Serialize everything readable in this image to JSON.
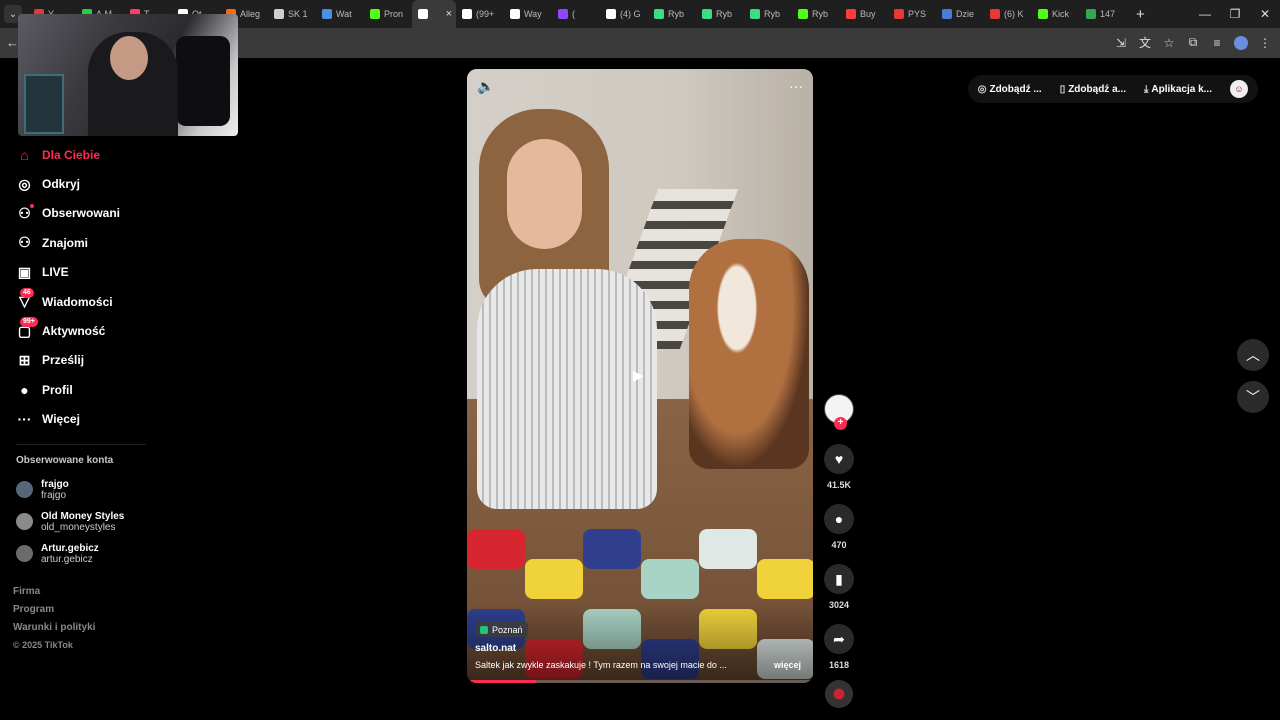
{
  "browser": {
    "tabs": [
      {
        "label": "Y",
        "color": "#e53935"
      },
      {
        "label": "A.M",
        "color": "#2ecc40"
      },
      {
        "label": "T",
        "color": "#ff3b6b"
      },
      {
        "label": "Ot",
        "color": "#ffffff"
      },
      {
        "label": "Alleg",
        "color": "#ff6a00"
      },
      {
        "label": "SK 1",
        "color": "#cfcfcf"
      },
      {
        "label": "Wat",
        "color": "#4a90e2"
      },
      {
        "label": "Pron",
        "color": "#53fc18"
      },
      {
        "label": "",
        "color": "#ffffff",
        "active": true
      },
      {
        "label": "(99+",
        "color": "#ffffff"
      },
      {
        "label": "Way",
        "color": "#ffffff"
      },
      {
        "label": "(",
        "color": "#9146ff"
      },
      {
        "label": "(4) G",
        "color": "#ffffff"
      },
      {
        "label": "Ryb",
        "color": "#3ddc84"
      },
      {
        "label": "Ryb",
        "color": "#3ddc84"
      },
      {
        "label": "Ryb",
        "color": "#3ddc84"
      },
      {
        "label": "Ryb",
        "color": "#53fc18"
      },
      {
        "label": "Buy",
        "color": "#ff3b3b"
      },
      {
        "label": "PYS",
        "color": "#e53935"
      },
      {
        "label": "Dzie",
        "color": "#4a7bd6"
      },
      {
        "label": "(6) K",
        "color": "#e53935"
      },
      {
        "label": "Kick",
        "color": "#53fc18"
      },
      {
        "label": "147",
        "color": "#34a853"
      }
    ],
    "new_tab": "+",
    "win_min": "—",
    "win_restore": "❐",
    "win_close": "✕"
  },
  "sidebar": {
    "items": [
      {
        "label": "Dla Ciebie",
        "icon": "home-icon",
        "glyph": "⌂",
        "active": true
      },
      {
        "label": "Odkryj",
        "icon": "compass-icon",
        "glyph": "◎"
      },
      {
        "label": "Obserwowani",
        "icon": "following-icon",
        "glyph": "⚇"
      },
      {
        "label": "Znajomi",
        "icon": "friends-icon",
        "glyph": "⚇"
      },
      {
        "label": "LIVE",
        "icon": "live-icon",
        "glyph": "▣"
      },
      {
        "label": "Wiadomości",
        "icon": "messages-icon",
        "glyph": "▽",
        "badge": "46"
      },
      {
        "label": "Aktywność",
        "icon": "activity-icon",
        "glyph": "▢",
        "badge": "99+"
      },
      {
        "label": "Prześlij",
        "icon": "upload-icon",
        "glyph": "⊞"
      },
      {
        "label": "Profil",
        "icon": "profile-icon",
        "glyph": "●"
      },
      {
        "label": "Więcej",
        "icon": "more-icon",
        "glyph": "···"
      }
    ],
    "following_title": "Obserwowane konta",
    "accounts": [
      {
        "name": "frajgo",
        "handle": "frajgo",
        "color": "#556677"
      },
      {
        "name": "Old Money Styles",
        "handle": "old_moneystyles",
        "color": "#8a8a8a"
      },
      {
        "name": "Artur.gebicz",
        "handle": "artur.gebicz",
        "color": "#6b6b6b"
      }
    ],
    "footer": [
      "Firma",
      "Program",
      "Warunki i polityki"
    ],
    "copyright": "© 2025 TikTok"
  },
  "top_actions": {
    "coins": "Zdobądź ...",
    "app": "Zdobądź a...",
    "desktop": "Aplikacja k..."
  },
  "video": {
    "location": "Poznań",
    "author": "salto.nat",
    "description": "Saltek jak zwykle zaskakuje ! Tym razem na swojej macie do ...",
    "more": "więcej",
    "progress": 0.2
  },
  "actions": {
    "likes": "41.5K",
    "comments": "470",
    "saves": "3024",
    "shares": "1618",
    "plus": "+"
  }
}
